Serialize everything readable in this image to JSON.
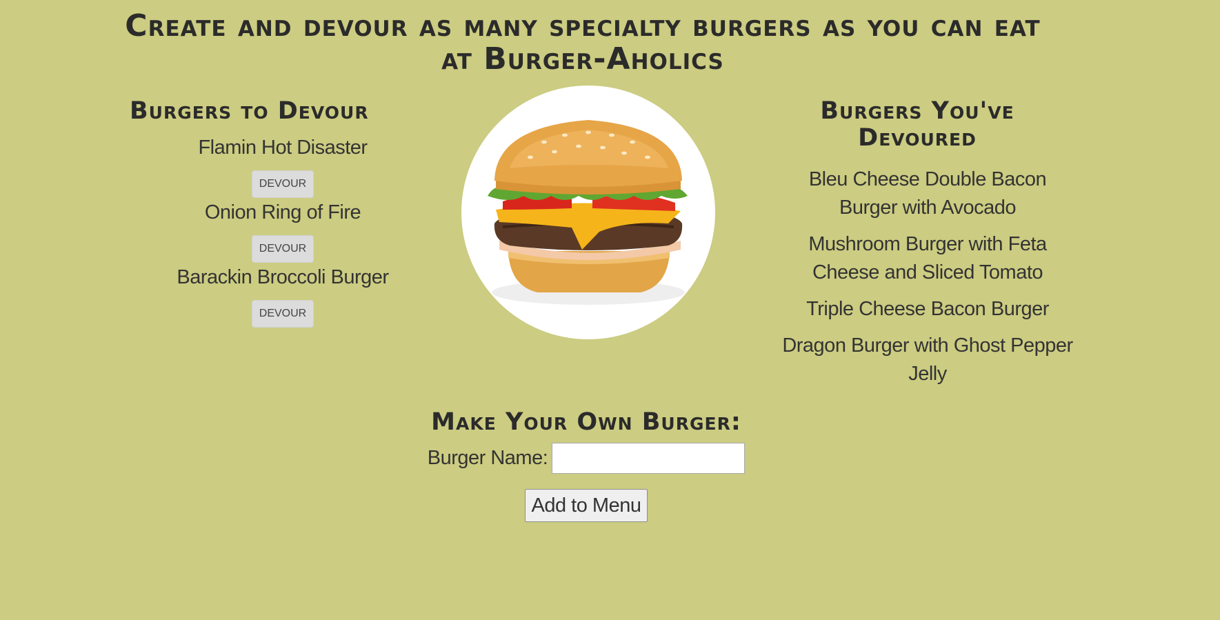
{
  "header": {
    "title": "Create and devour as many specialty burgers as you can eat at Burger-Aholics"
  },
  "to_devour": {
    "heading": "Burgers to Devour",
    "button_label": "DEVOUR",
    "items": [
      {
        "name": "Flamin Hot Disaster"
      },
      {
        "name": "Onion Ring of Fire"
      },
      {
        "name": "Barackin Broccoli Burger"
      }
    ]
  },
  "devoured": {
    "heading": "Burgers You've Devoured",
    "items": [
      {
        "name": "Bleu Cheese Double Bacon Burger with Avocado"
      },
      {
        "name": "Mushroom Burger with Feta Cheese and Sliced Tomato"
      },
      {
        "name": "Triple Cheese Bacon Burger"
      },
      {
        "name": "Dragon Burger with Ghost Pepper Jelly"
      }
    ]
  },
  "make": {
    "heading": "Make Your Own Burger:",
    "label": "Burger Name:",
    "input_value": "",
    "submit_label": "Add to Menu"
  },
  "colors": {
    "background": "#cccc82",
    "text": "#2f2f2f",
    "button": "#dcdcdc"
  }
}
